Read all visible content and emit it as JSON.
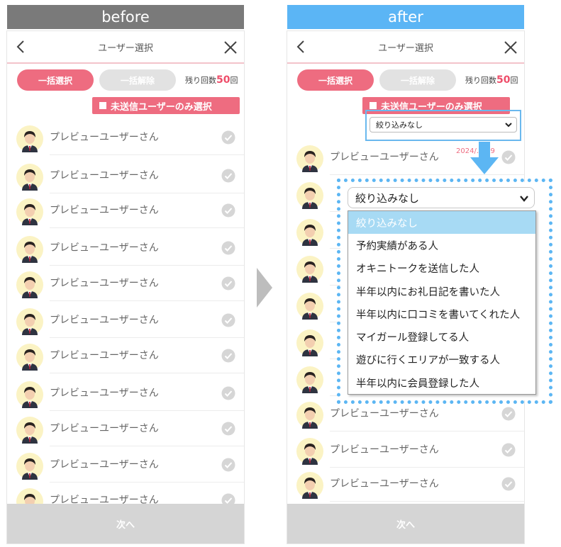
{
  "labels": {
    "before": "before",
    "after": "after"
  },
  "header": {
    "title": "ユーザー選択"
  },
  "buttons": {
    "select_all": "一括選択",
    "clear_all": "一括解除",
    "unsent_only": "未送信ユーザーのみ選択",
    "next": "次へ"
  },
  "remaining": {
    "prefix": "残り回数",
    "count": "50",
    "suffix": "回"
  },
  "user": {
    "name": "プレビューユーザーさん"
  },
  "filter": {
    "selected": "絞り込みなし",
    "options": [
      "絞り込みなし",
      "予約実績がある人",
      "オキニトークを送信した人",
      "半年以内にお礼日記を書いた人",
      "半年以内に口コミを書いてくれた人",
      "マイガール登録してる人",
      "遊びに行くエリアが一致する人",
      "半年以内に会員登録した人"
    ]
  },
  "after_row_date": "2024/…/09",
  "colors": {
    "accent": "#ee6c80",
    "highlight": "#5cb6f3"
  }
}
